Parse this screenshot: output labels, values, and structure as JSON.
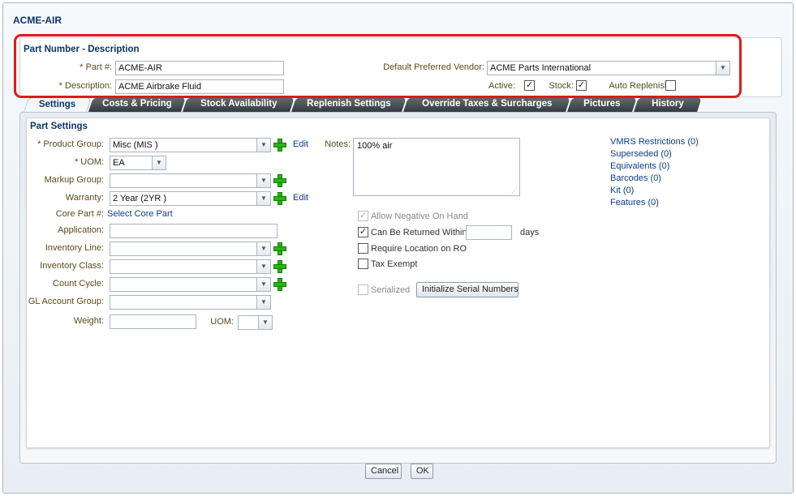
{
  "window": {
    "title": "ACME-AIR"
  },
  "header": {
    "section_title": "Part Number - Description",
    "part_label": "* Part #:",
    "part_value": "ACME-AIR",
    "description_label": "* Description:",
    "description_value": "ACME Airbrake Fluid",
    "vendor_label": "Default Preferred Vendor:",
    "vendor_value": "ACME Parts International",
    "active_label": "Active:",
    "stock_label": "Stock:",
    "auto_replenish_label": "Auto Replenish:",
    "active_checked": true,
    "stock_checked": true,
    "auto_replenish_checked": false
  },
  "tabs": [
    {
      "label": "Settings",
      "active": true
    },
    {
      "label": "Costs & Pricing"
    },
    {
      "label": "Stock Availability"
    },
    {
      "label": "Replenish Settings"
    },
    {
      "label": "Override Taxes & Surcharges"
    },
    {
      "label": "Pictures"
    },
    {
      "label": "History"
    }
  ],
  "settings": {
    "section_title": "Part Settings",
    "product_group_label": "* Product Group:",
    "product_group_value": "Misc (MIS )",
    "uom_label": "* UOM:",
    "uom_value": "EA",
    "markup_group_label": "Markup Group:",
    "markup_group_value": "",
    "warranty_label": "Warranty:",
    "warranty_value": "2 Year (2YR )",
    "core_part_label": "Core Part #:",
    "core_part_link": "Select Core Part",
    "application_label": "Application:",
    "application_value": "",
    "inventory_line_label": "Inventory Line:",
    "inventory_class_label": "Inventory Class:",
    "count_cycle_label": "Count Cycle:",
    "gl_account_label": "GL Account Group:",
    "weight_label": "Weight:",
    "weight_uom_label": "UOM:",
    "edit_label": "Edit",
    "notes_label": "Notes:",
    "notes_value": "100% air",
    "allow_negative_label": "Allow Negative On Hand",
    "can_be_returned_label": "Can Be Returned Within",
    "days_label": "days",
    "require_location_label": "Require Location on RO",
    "tax_exempt_label": "Tax Exempt",
    "serialized_label": "Serialized",
    "init_serial_button": "Initialize Serial Numbers",
    "allow_negative_checked": true,
    "can_be_returned_checked": true
  },
  "links": [
    "VMRS Restrictions (0)",
    "Superseded (0)",
    "Equivalents (0)",
    "Barcodes (0)",
    "Kit (0)",
    "Features (0)"
  ],
  "footer": {
    "cancel_label": "Cancel",
    "ok_label": "OK"
  },
  "colors": {
    "highlight_outline": "#e01a1a",
    "add_icon": "#27b512",
    "link": "#0c3c8a"
  }
}
